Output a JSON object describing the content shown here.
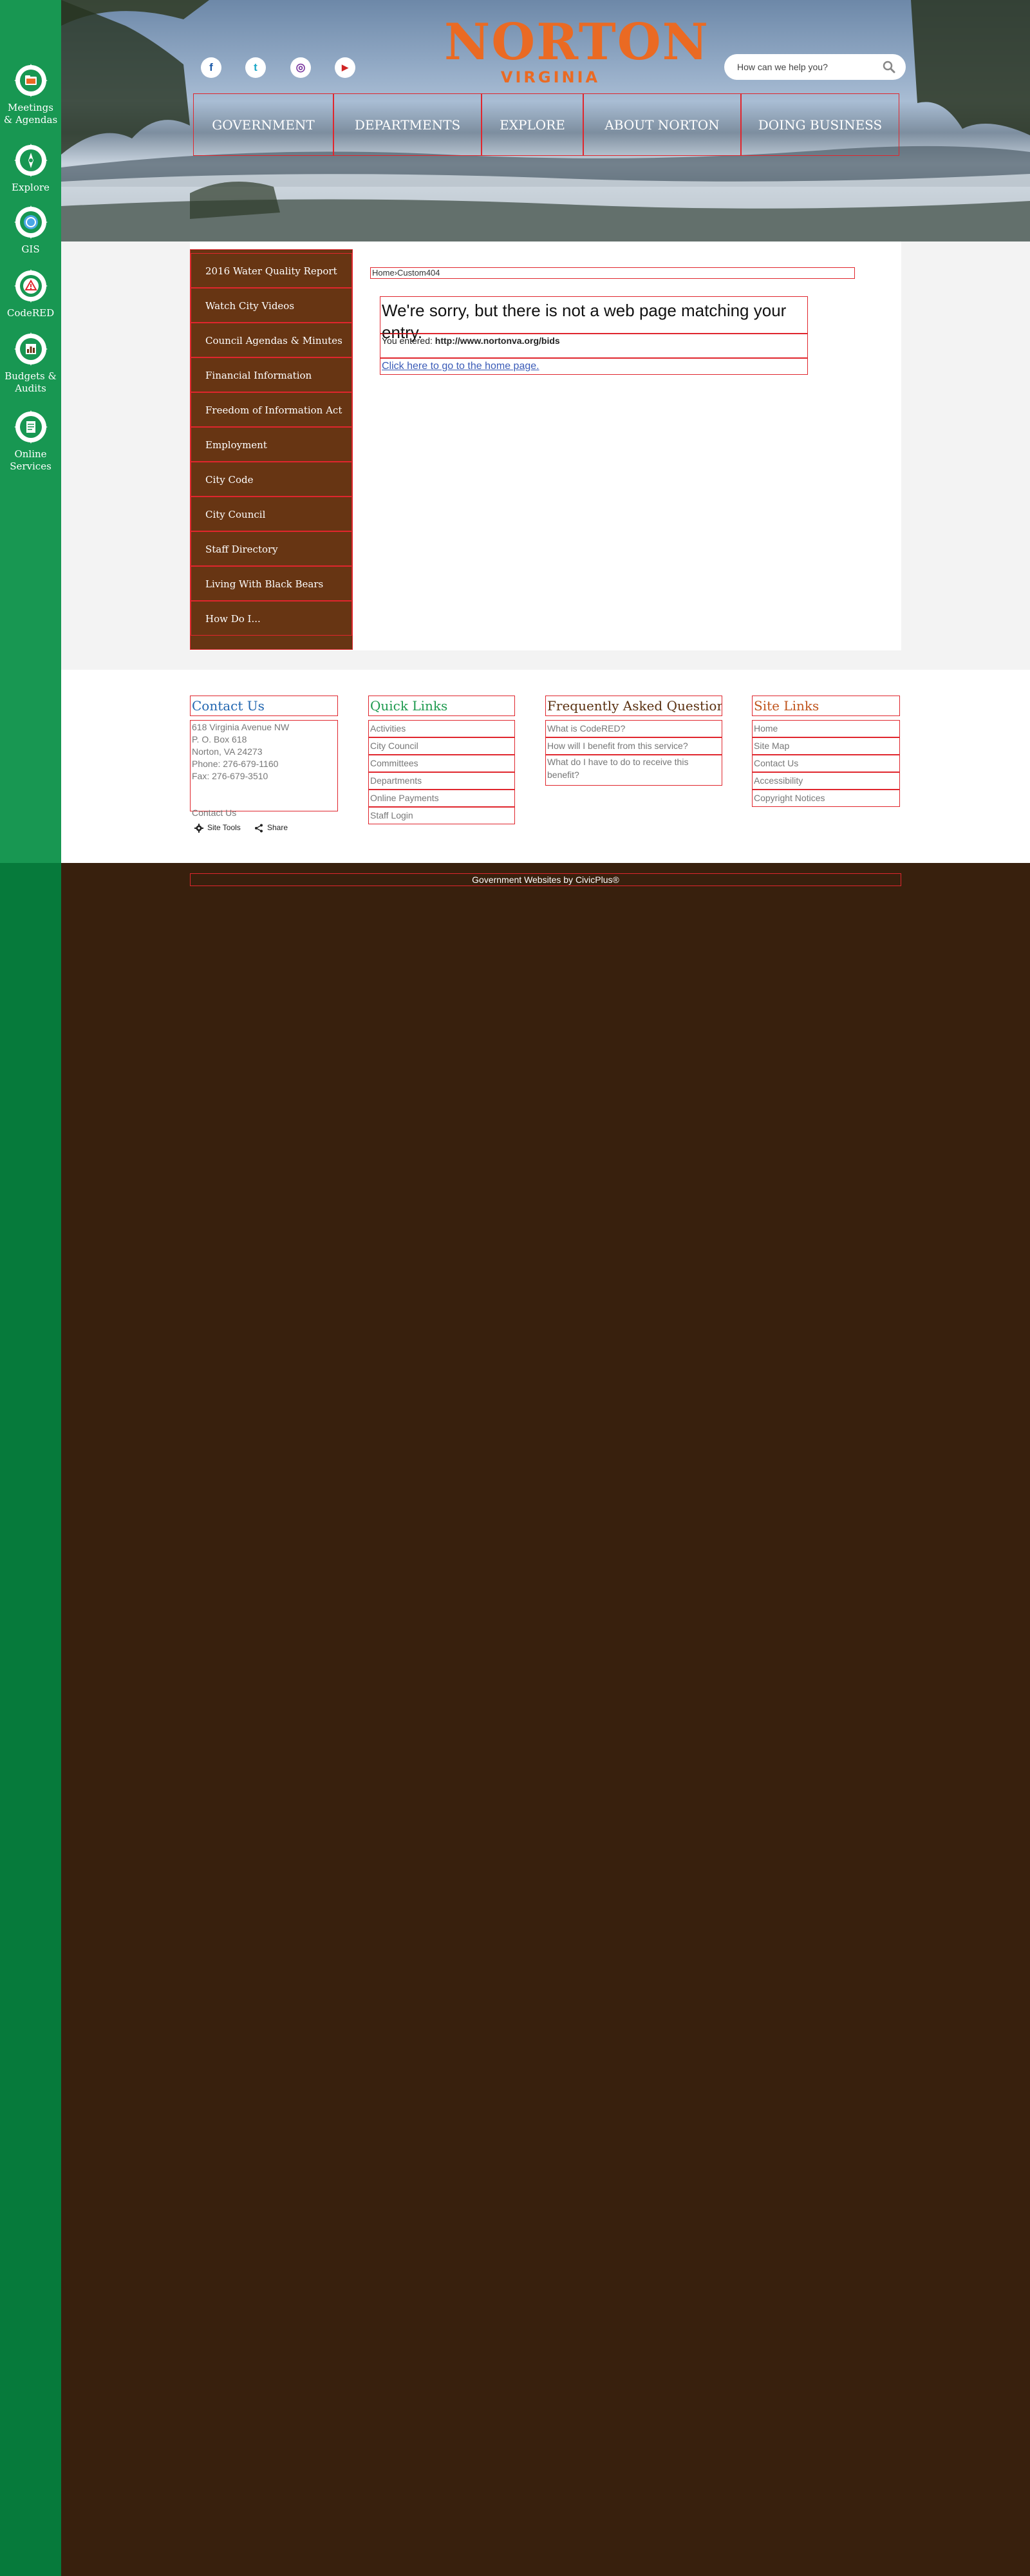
{
  "rail": {
    "items": [
      {
        "label": "Meetings & Agendas",
        "icon": "folder-icon"
      },
      {
        "label": "Explore",
        "icon": "compass-icon"
      },
      {
        "label": "GIS",
        "icon": "globe-icon"
      },
      {
        "label": "CodeRED",
        "icon": "warning-icon"
      },
      {
        "label": "Budgets & Audits",
        "icon": "bar-chart-icon"
      },
      {
        "label": "Online Services",
        "icon": "document-icon"
      }
    ]
  },
  "header": {
    "logo_name": "NORTON",
    "logo_sub": "VIRGINIA",
    "social": [
      {
        "glyph": "f",
        "icon": "facebook-icon"
      },
      {
        "glyph": "t",
        "icon": "twitter-icon"
      },
      {
        "glyph": "◎",
        "icon": "instagram-icon"
      },
      {
        "glyph": "▶",
        "icon": "youtube-icon"
      }
    ],
    "search_placeholder": "How can we help you?",
    "nav": [
      "GOVERNMENT",
      "DEPARTMENTS",
      "EXPLORE",
      "ABOUT NORTON",
      "DOING BUSINESS"
    ]
  },
  "subnav": {
    "items": [
      "2016 Water Quality Report",
      "Watch City Videos",
      "Council Agendas & Minutes",
      "Financial Information",
      "Freedom of Information Act",
      "Employment",
      "City Code",
      "City Council",
      "Staff Directory",
      "Living With Black Bears",
      "How Do I..."
    ]
  },
  "content": {
    "breadcrumb_home": "Home",
    "breadcrumb_sep": "›",
    "breadcrumb_current": "Custom404",
    "error_title": "We're sorry, but there is not a web page matching your entry.",
    "entered_label": "You entered:",
    "entered_url": "http://www.nortonva.org/bids",
    "home_link": "Click here to go to the home page."
  },
  "footer": {
    "contact": {
      "heading": "Contact Us",
      "lines": [
        "618 Virginia Avenue NW",
        "P. O. Box 618",
        "Norton, VA 24273",
        "Phone: 276-679-1160",
        "Fax: 276-679-3510"
      ],
      "link": "Contact Us"
    },
    "quick_links": {
      "heading": "Quick Links",
      "items": [
        "Activities",
        "City Council",
        "Committees",
        "Departments",
        "Online Payments",
        "Staff Login"
      ]
    },
    "faq": {
      "heading": "Frequently Asked Questions",
      "items": [
        "What is CodeRED?",
        "How will I benefit from this service?",
        "What do I have to do to receive this benefit?"
      ]
    },
    "site_links": {
      "heading": "Site Links",
      "items": [
        "Home",
        "Site Map",
        "Contact Us",
        "Accessibility",
        "Copyright Notices"
      ]
    },
    "tools": {
      "site_tools": "Site Tools",
      "share": "Share"
    },
    "credit": "Government Websites by CivicPlus®"
  },
  "colors": {
    "rail_green": "#067a3b",
    "rail_green_light": "#189752",
    "brand_orange": "#ea6a23",
    "subnav_brown": "#673513",
    "bottom_brown": "#38200d",
    "contact_heading": "#2266b0",
    "quick_links_heading": "#1e9a4e",
    "faq_heading": "#5a3010",
    "site_links_heading": "#c0541c"
  }
}
